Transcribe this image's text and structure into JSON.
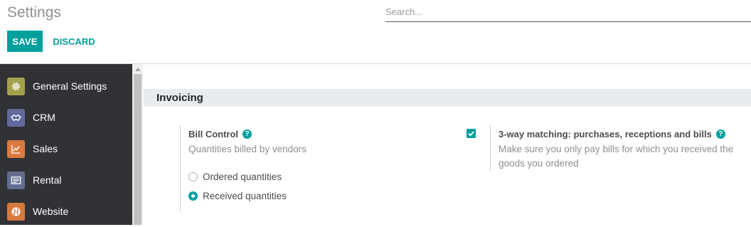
{
  "header": {
    "title": "Settings",
    "search_placeholder": "Search...",
    "save_label": "SAVE",
    "discard_label": "DISCARD"
  },
  "sidebar": {
    "items": [
      {
        "label": "General Settings",
        "icon": "gear-icon",
        "color": "#a5a14a"
      },
      {
        "label": "CRM",
        "icon": "handshake-icon",
        "color": "#606a9c"
      },
      {
        "label": "Sales",
        "icon": "chart-line-icon",
        "color": "#dd7a40"
      },
      {
        "label": "Rental",
        "icon": "rental-icon",
        "color": "#636f91"
      },
      {
        "label": "Website",
        "icon": "globe-icon",
        "color": "#d7783d"
      }
    ]
  },
  "section": {
    "title": "Invoicing"
  },
  "settings": {
    "bill_control": {
      "title": "Bill Control",
      "description": "Quantities billed by vendors",
      "options": [
        {
          "label": "Ordered quantities",
          "selected": false
        },
        {
          "label": "Received quantities",
          "selected": true
        }
      ]
    },
    "three_way_matching": {
      "title": "3-way matching: purchases, receptions and bills",
      "description_line1": "Make sure you only pay bills for which you received the",
      "description_line2": "goods you ordered",
      "checked": true
    }
  },
  "colors": {
    "accent": "#00a09d",
    "sidebar_bg": "#303236",
    "section_bg": "#e9ecef"
  }
}
